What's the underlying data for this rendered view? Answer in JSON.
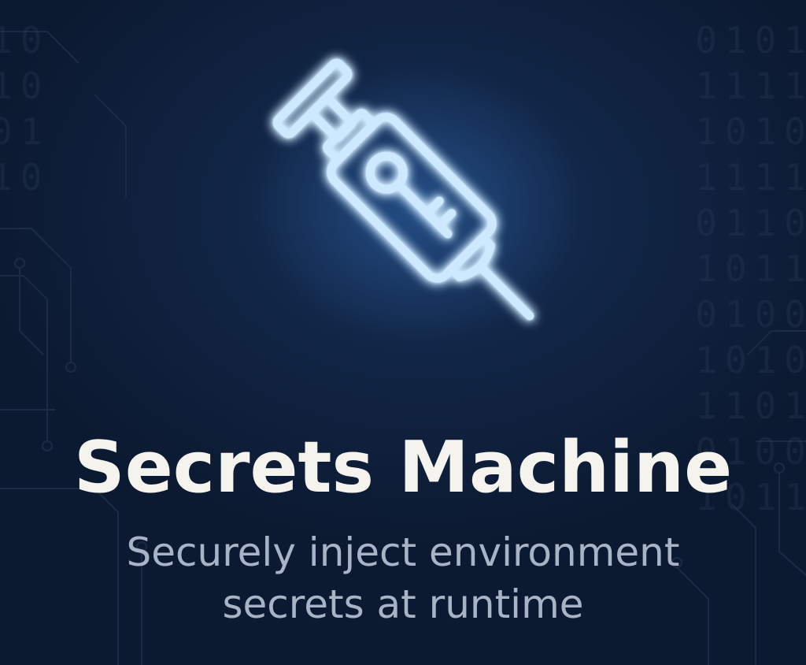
{
  "hero": {
    "title": "Secrets Machine",
    "subtitle_line1": "Securely inject environment",
    "subtitle_line2": "secrets at runtime"
  },
  "icon": {
    "name": "syringe-key-icon",
    "glow_color": "#8ecbff",
    "stroke_color": "#cde9ff"
  },
  "colors": {
    "background": "#0f1c33",
    "title": "#f5f3ee",
    "subtitle": "#a9b3c6"
  },
  "background_decoration": {
    "binary_right": "0101\n1111\n1010\n1111\n0110\n1011\n0100\n1010\n1101\n0100\n1011",
    "binary_left": "10\n10\n01\n10"
  }
}
